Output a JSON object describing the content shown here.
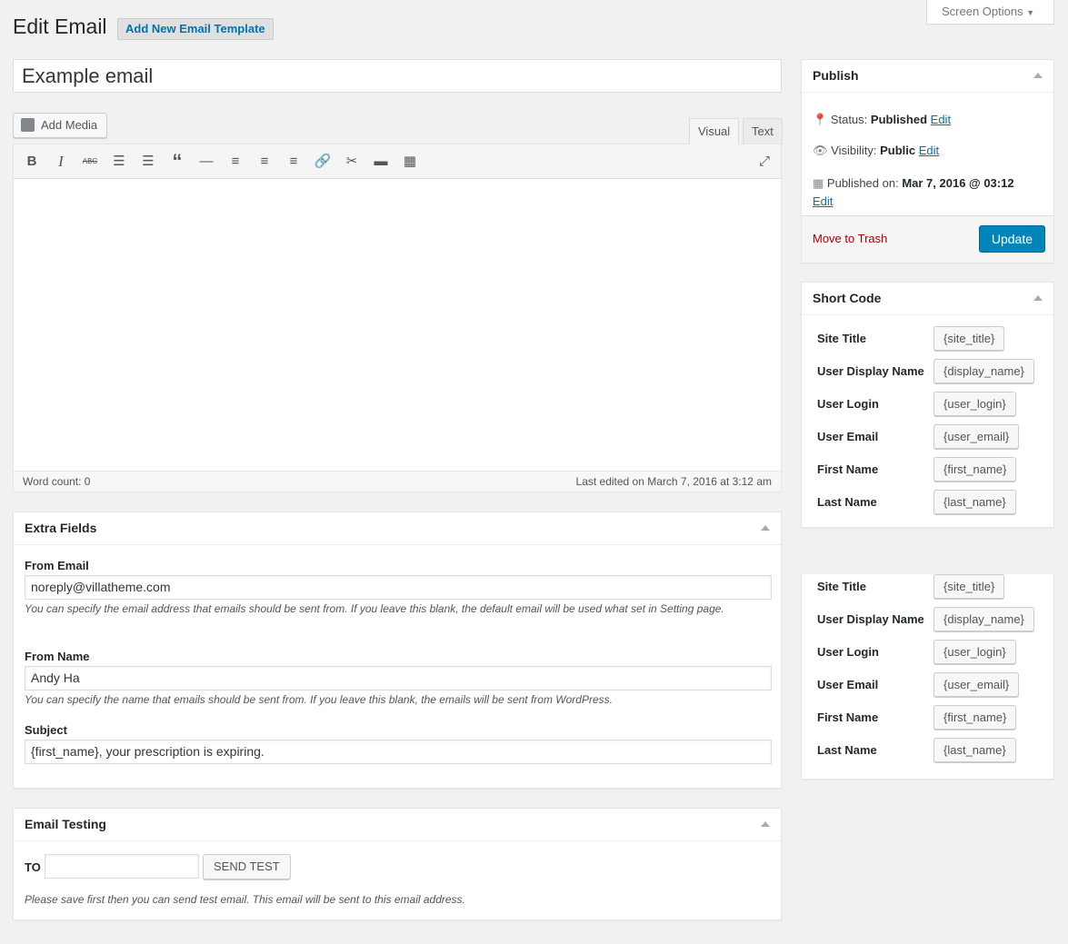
{
  "header": {
    "title": "Edit Email",
    "add_new": "Add New Email Template",
    "screen_options": "Screen Options"
  },
  "post": {
    "title": "Example email"
  },
  "editor": {
    "add_media": "Add Media",
    "tabs": [
      "Visual",
      "Text"
    ],
    "toolbar": [
      "bold-icon",
      "italic-icon",
      "strikethrough-icon",
      "bulleted-list-icon",
      "numbered-list-icon",
      "blockquote-icon",
      "horizontal-line-icon",
      "align-left-icon",
      "align-center-icon",
      "align-right-icon",
      "link-icon",
      "unlink-icon",
      "read-more-icon",
      "toolbar-toggle-icon",
      "fullscreen-icon"
    ],
    "word_count": "Word count: 0",
    "last_edited": "Last edited on March 7, 2016 at 3:12 am"
  },
  "extra_fields": {
    "title": "Extra Fields",
    "from_email": {
      "label": "From Email",
      "value": "noreply@villatheme.com",
      "desc": "You can specify the email address that emails should be sent from. If you leave this blank, the default email will be used what set in Setting page."
    },
    "from_name": {
      "label": "From Name",
      "value": "Andy Ha",
      "desc": "You can specify the name that emails should be sent from. If you leave this blank, the emails will be sent from WordPress."
    },
    "subject": {
      "label": "Subject",
      "value": "{first_name}, your prescription is expiring."
    }
  },
  "email_testing": {
    "title": "Email Testing",
    "to_label": "TO",
    "to_value": "",
    "send": "SEND TEST",
    "desc": "Please save first then you can send test email. This email will be sent to this email address."
  },
  "publish": {
    "title": "Publish",
    "status_label": "Status:",
    "status": "Published",
    "visibility_label": "Visibility:",
    "visibility": "Public",
    "published_label": "Published on:",
    "published": "Mar 7, 2016 @ 03:12",
    "edit": "Edit",
    "trash": "Move to Trash",
    "update": "Update"
  },
  "shortcode": {
    "title": "Short Code",
    "items": [
      {
        "label": "Site Title",
        "code": "{site_title}"
      },
      {
        "label": "User Display Name",
        "code": "{display_name}"
      },
      {
        "label": "User Login",
        "code": "{user_login}"
      },
      {
        "label": "User Email",
        "code": "{user_email}"
      },
      {
        "label": "First Name",
        "code": "{first_name}"
      },
      {
        "label": "Last Name",
        "code": "{last_name}"
      }
    ]
  },
  "colors": {
    "primary": "#0085ba",
    "link": "#0073aa",
    "trash": "#a00"
  }
}
